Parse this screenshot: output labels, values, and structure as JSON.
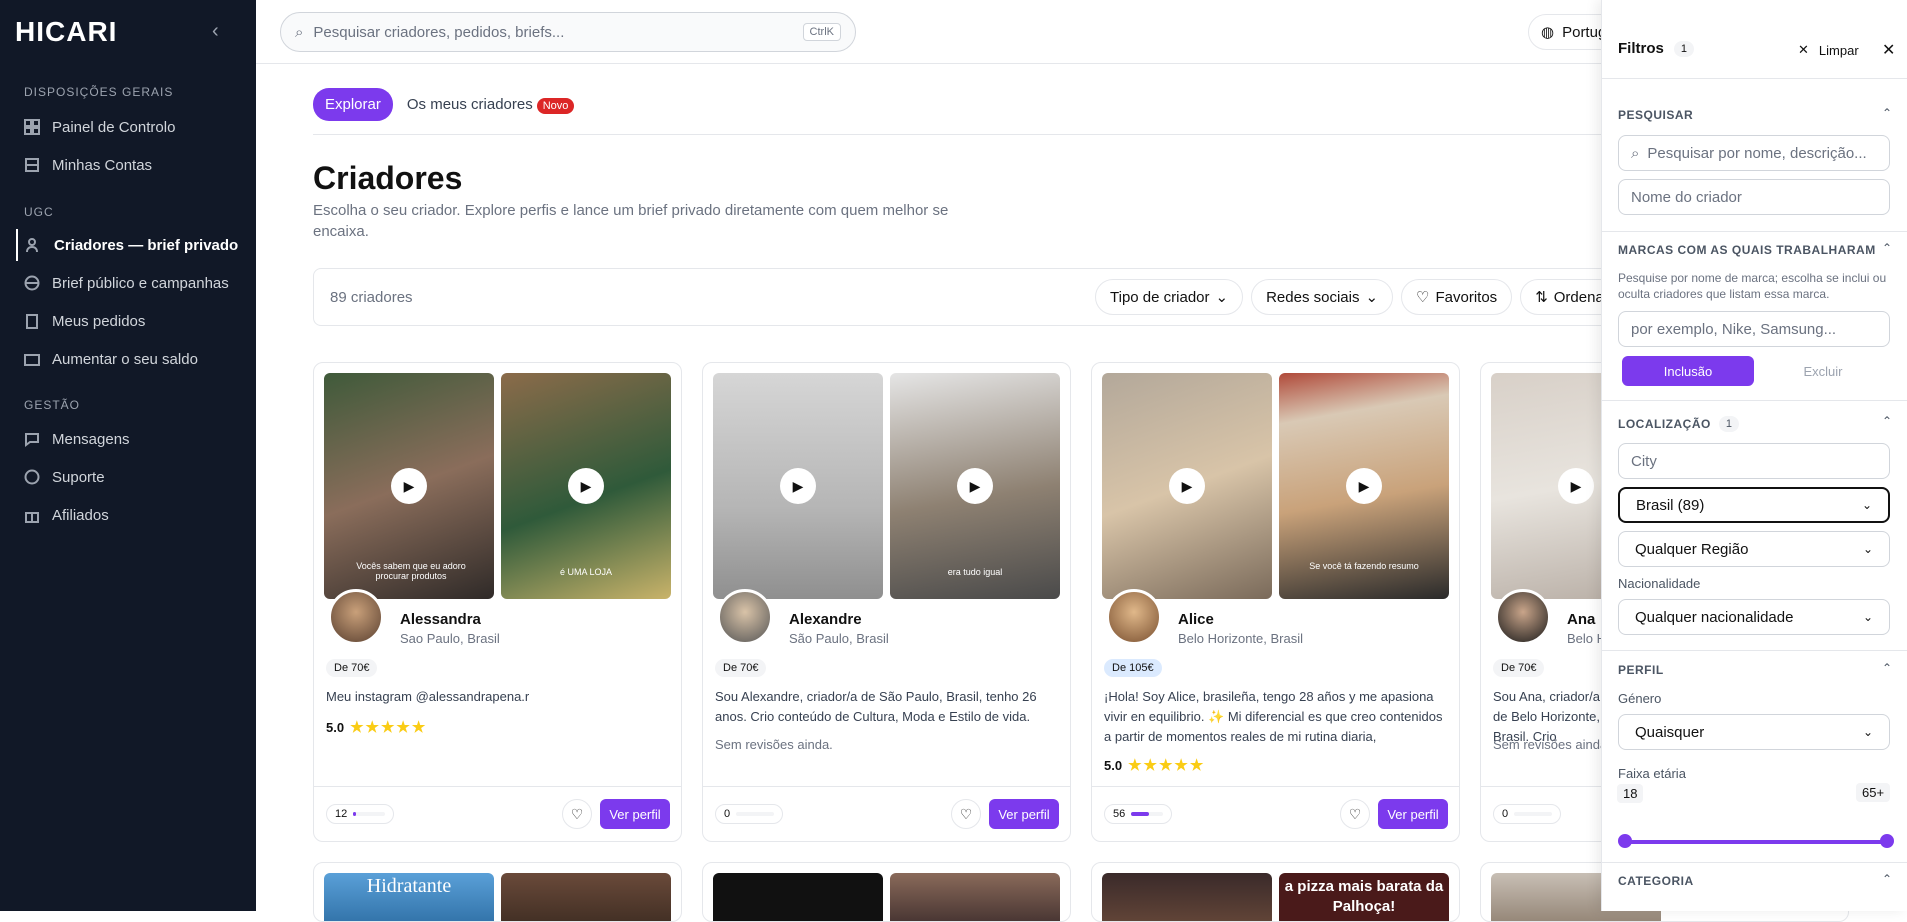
{
  "brand": {
    "logo": "HICARI"
  },
  "sidebar": {
    "sections": [
      "DISPOSIÇÕES GERAIS",
      "UGC",
      "GESTÃO"
    ],
    "items": [
      {
        "label": "Painel de Controlo",
        "icon": "dashboard-icon"
      },
      {
        "label": "Minhas Contas",
        "icon": "grid-icon"
      },
      {
        "label": "Criadores — brief privado",
        "icon": "users-icon"
      },
      {
        "label": "Brief público e campanhas",
        "icon": "globe-icon"
      },
      {
        "label": "Meus pedidos",
        "icon": "clipboard-icon"
      },
      {
        "label": "Aumentar o seu saldo",
        "icon": "wallet-icon"
      },
      {
        "label": "Mensagens",
        "icon": "message-icon"
      },
      {
        "label": "Suporte",
        "icon": "help-icon"
      },
      {
        "label": "Afiliados",
        "icon": "gift-icon"
      }
    ]
  },
  "topbar": {
    "search_placeholder": "Pesquisar criadores, pedidos, briefs...",
    "shortcut": "CtrlK",
    "language": "Português"
  },
  "tabs": {
    "explore": "Explorar",
    "mine": "Os meus criadores",
    "new_badge": "Novo"
  },
  "page": {
    "title": "Criadores",
    "subtitle": "Escolha o seu criador. Explore perfis e lance um brief privado diretamente com quem melhor se encaixa."
  },
  "filterbar": {
    "count": "89 criadores",
    "type": "Tipo de criador",
    "social": "Redes sociais",
    "favorites": "Favoritos",
    "order": "Ordenar"
  },
  "cards": [
    {
      "name": "Alessandra",
      "location": "Sao Paulo, Brasil",
      "price": "De 70€",
      "desc": "Meu instagram @alessandrapena.r",
      "rating": "5.0",
      "stars": "★★★★★",
      "reviews": "",
      "meter": "12",
      "meter_fraction": 0.1,
      "caption1": "Vocês sabem que eu adoro procurar produtos",
      "caption2": "é UMA LOJA"
    },
    {
      "name": "Alexandre",
      "location": "São Paulo, Brasil",
      "price": "De 70€",
      "desc": "Sou Alexandre, criador/a de São Paulo, Brasil, tenho 26 anos. Crio conteúdo de Cultura, Moda e Estilo de vida.",
      "rating": "",
      "stars": "",
      "reviews": "Sem revisões ainda.",
      "meter": "0",
      "meter_fraction": 0,
      "caption1": "",
      "caption2": "era tudo igual"
    },
    {
      "name": "Alice",
      "location": "Belo Horizonte, Brasil",
      "price": "De 105€",
      "desc": "¡Hola! Soy Alice, brasileña, tengo 28 años y me apasiona vivir en equilibrio. ✨ Mi diferencial es que creo contenidos a partir de momentos reales de mi rutina diaria, generando...",
      "rating": "5.0",
      "stars": "★★★★★",
      "reviews": "",
      "meter": "56",
      "meter_fraction": 0.55,
      "caption1": "",
      "caption2": "Se você tá fazendo resumo"
    },
    {
      "name": "Ana",
      "location": "Belo Horizonte, Brasil",
      "price": "De 70€",
      "desc": "Sou Ana, criador/a de Belo Horizonte, Brasil. Crio conteúdo de Beleza.",
      "rating": "",
      "stars": "",
      "reviews": "Sem revisões ainda.",
      "meter": "0",
      "meter_fraction": 0,
      "caption1": "",
      "caption2": ""
    }
  ],
  "card_button": "Ver perfil",
  "row2_captions": [
    "Hidratante",
    "a pizza mais barata da Palhoça!"
  ],
  "panel": {
    "title": "Filtros",
    "badge": "1",
    "clear": "Limpar",
    "search": {
      "title": "PESQUISAR",
      "placeholder": "Pesquisar por nome, descrição...",
      "creator_placeholder": "Nome do criador"
    },
    "brands": {
      "title": "MARCAS COM AS QUAIS TRABALHARAM",
      "help": "Pesquise por nome de marca; escolha se inclui ou oculta criadores que listam essa marca.",
      "placeholder": "por exemplo, Nike, Samsung...",
      "include": "Inclusão",
      "exclude": "Excluir"
    },
    "location": {
      "title": "LOCALIZAÇÃO",
      "badge": "1",
      "city_placeholder": "City",
      "country": "Brasil (89)",
      "region": "Qualquer Região",
      "nationality_label": "Nacionalidade",
      "nationality": "Qualquer nacionalidade"
    },
    "profile": {
      "title": "PERFIL",
      "gender_label": "Género",
      "gender": "Quaisquer",
      "age_label": "Faixa etária",
      "age_min": "18",
      "age_max": "65+"
    },
    "category": {
      "title": "CATEGORIA"
    }
  },
  "colors": {
    "accent": "#7c3aed",
    "sidebar_bg": "#111827",
    "new_badge": "#dc2626",
    "star": "#facc15"
  }
}
